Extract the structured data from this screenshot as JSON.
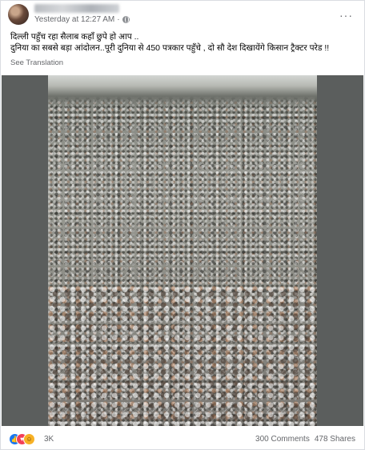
{
  "post": {
    "timestamp": "Yesterday at 12:27 AM",
    "separator": "·",
    "more_label": "···",
    "text_line_1": "दिल्ली पहुँच रहा सैलाब कहाँ छुपे हो आप ..",
    "text_line_2": "दुनिया का सबसे बड़ा आंदोलन..पूरी दुनिया से 450 पत्रकार पहुँचे ,  दो सौ देश दिखायेंगे किसान ट्रैक्टर परेड !!",
    "see_translation": "See Translation"
  },
  "footer": {
    "reaction_count": "3K",
    "comments": "300 Comments",
    "shares": "478 Shares",
    "reactions": [
      "like-icon",
      "love-icon",
      "care-icon"
    ]
  }
}
